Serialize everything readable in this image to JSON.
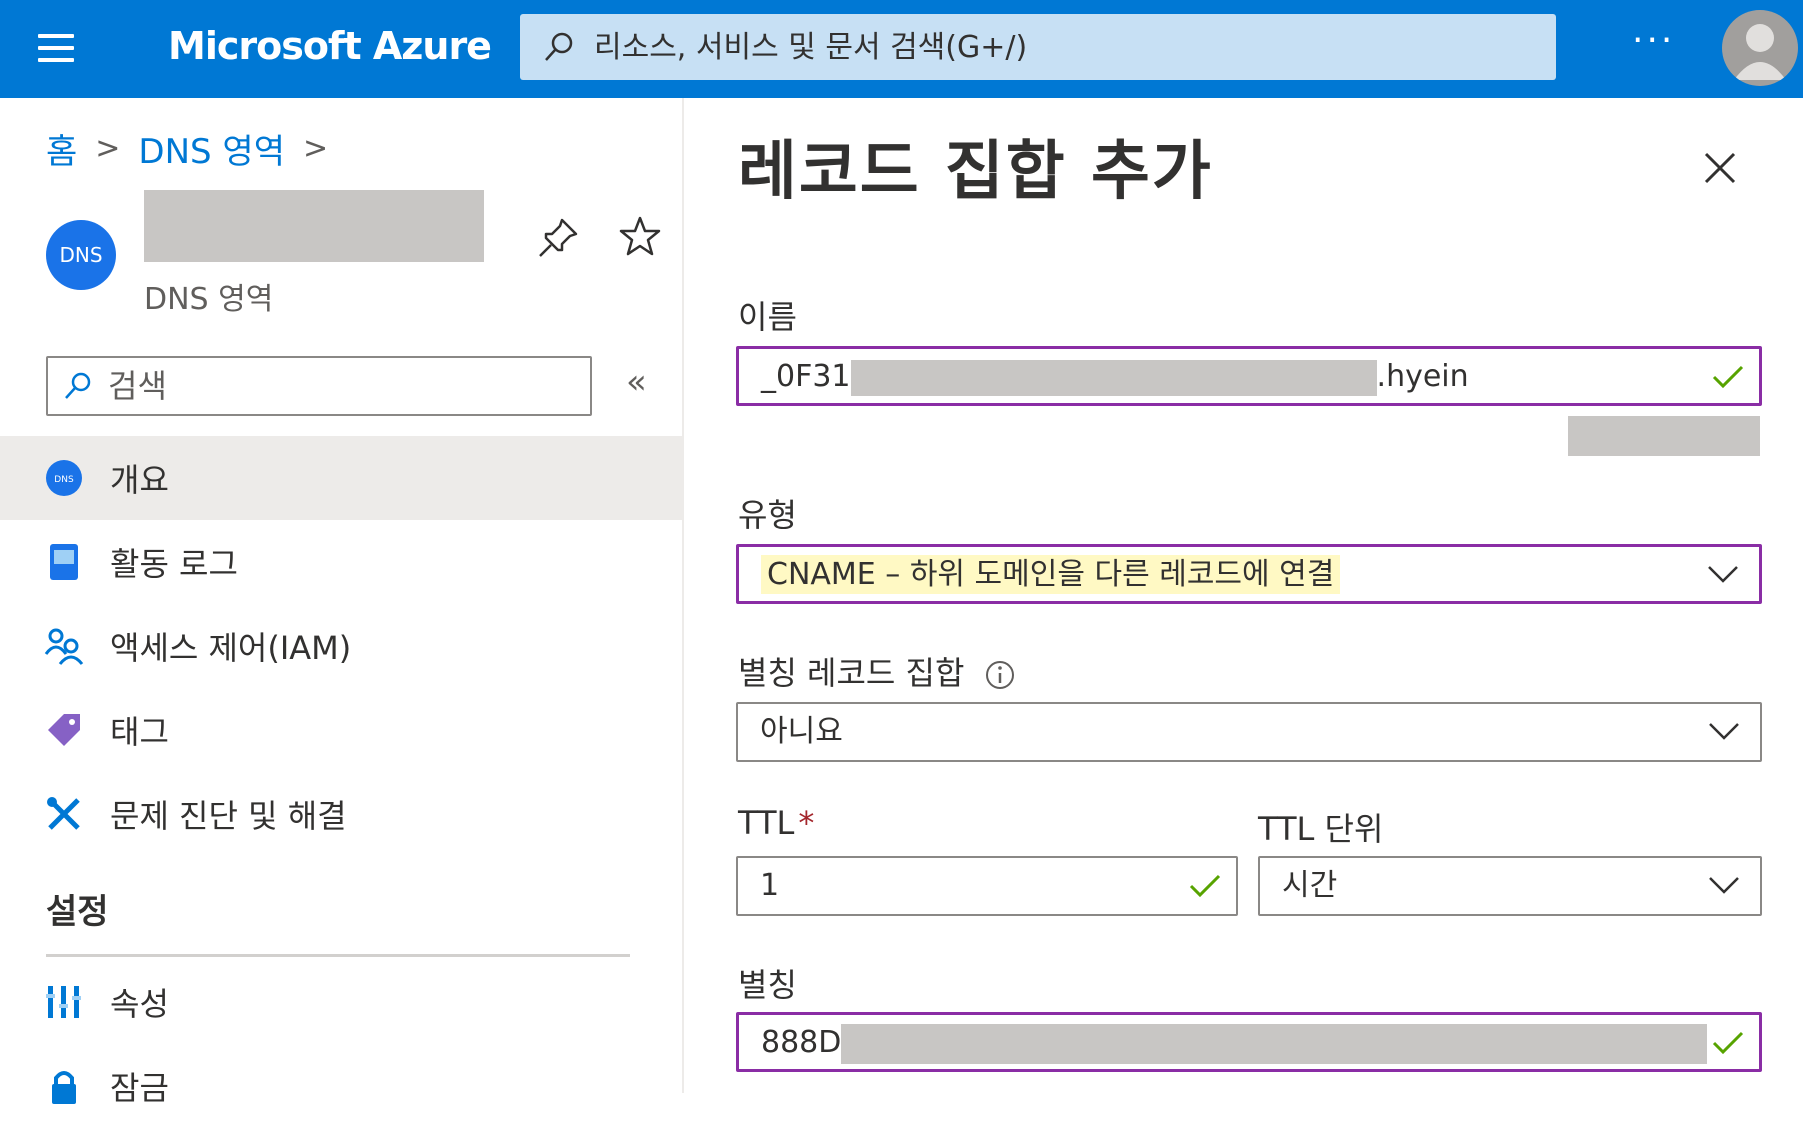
{
  "topbar": {
    "brand": "Microsoft Azure",
    "search_placeholder": "리소스, 서비스 및 문서 검색(G+/)",
    "more_label": "···"
  },
  "breadcrumb": {
    "home": "홈",
    "dns_zones": "DNS 영역",
    "separator": ">"
  },
  "resource": {
    "icon_text": "DNS",
    "subtitle": "DNS 영역"
  },
  "left_search": {
    "placeholder": "검색"
  },
  "collapse_label": "«",
  "nav": {
    "items": [
      {
        "label": "개요",
        "icon": "dns-icon",
        "active": true
      },
      {
        "label": "활동 로그",
        "icon": "activity-log-icon"
      },
      {
        "label": "액세스 제어(IAM)",
        "icon": "access-control-icon"
      },
      {
        "label": "태그",
        "icon": "tag-icon"
      },
      {
        "label": "문제 진단 및 해결",
        "icon": "diagnose-icon"
      }
    ],
    "settings_title": "설정",
    "settings_items": [
      {
        "label": "속성",
        "icon": "properties-icon"
      },
      {
        "label": "잠금",
        "icon": "lock-icon"
      }
    ]
  },
  "panel": {
    "title": "레코드 집합 추가",
    "fields": {
      "name": {
        "label": "이름",
        "prefix": "_0F31",
        "suffix": ".hyein"
      },
      "type": {
        "label": "유형",
        "value": "CNAME – 하위 도메인을 다른 레코드에 연결"
      },
      "alias_record_set": {
        "label": "별칭 레코드 집합",
        "value": "아니요"
      },
      "ttl": {
        "label": "TTL",
        "required_mark": "*",
        "value": "1"
      },
      "ttl_unit": {
        "label": "TTL 단위",
        "value": "시간"
      },
      "alias": {
        "label": "별칭",
        "prefix": "888D"
      }
    }
  },
  "colors": {
    "accent": "#0078d4",
    "focus_border": "#8a2da5",
    "check": "#57a300",
    "required": "#a4262c"
  }
}
